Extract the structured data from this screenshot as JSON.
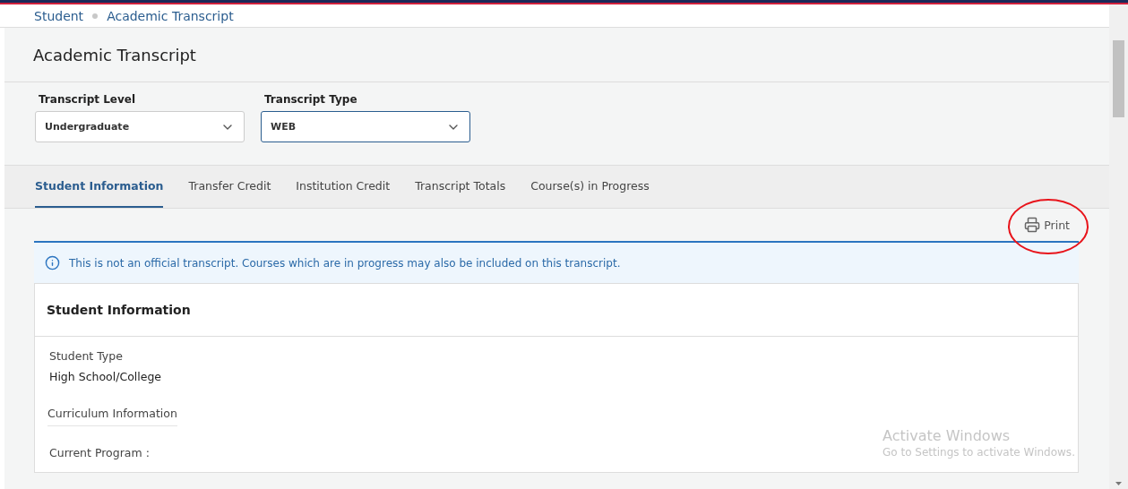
{
  "breadcrumb": [
    "Student",
    "Academic Transcript"
  ],
  "page_title": "Academic Transcript",
  "filters": [
    {
      "label": "Transcript Level",
      "value": "Undergraduate",
      "focused": false
    },
    {
      "label": "Transcript Type",
      "value": "WEB",
      "focused": true
    }
  ],
  "tabs": [
    {
      "label": "Student Information",
      "selected": true
    },
    {
      "label": "Transfer Credit",
      "selected": false
    },
    {
      "label": "Institution Credit",
      "selected": false
    },
    {
      "label": "Transcript Totals",
      "selected": false
    },
    {
      "label": "Course(s) in Progress",
      "selected": false
    }
  ],
  "print_button": {
    "label": "Print",
    "highlighted": true
  },
  "notice": "This is not an official transcript. Courses which are in progress may also be included on this transcript.",
  "card": {
    "title": "Student Information",
    "student_type_label": "Student Type",
    "student_type_value": "High School/College",
    "section_heading": "Curriculum Information",
    "current_program_label": "Current Program :"
  },
  "os_notice": {
    "title": "Activate Windows",
    "text": "Go to Settings to activate Windows."
  }
}
